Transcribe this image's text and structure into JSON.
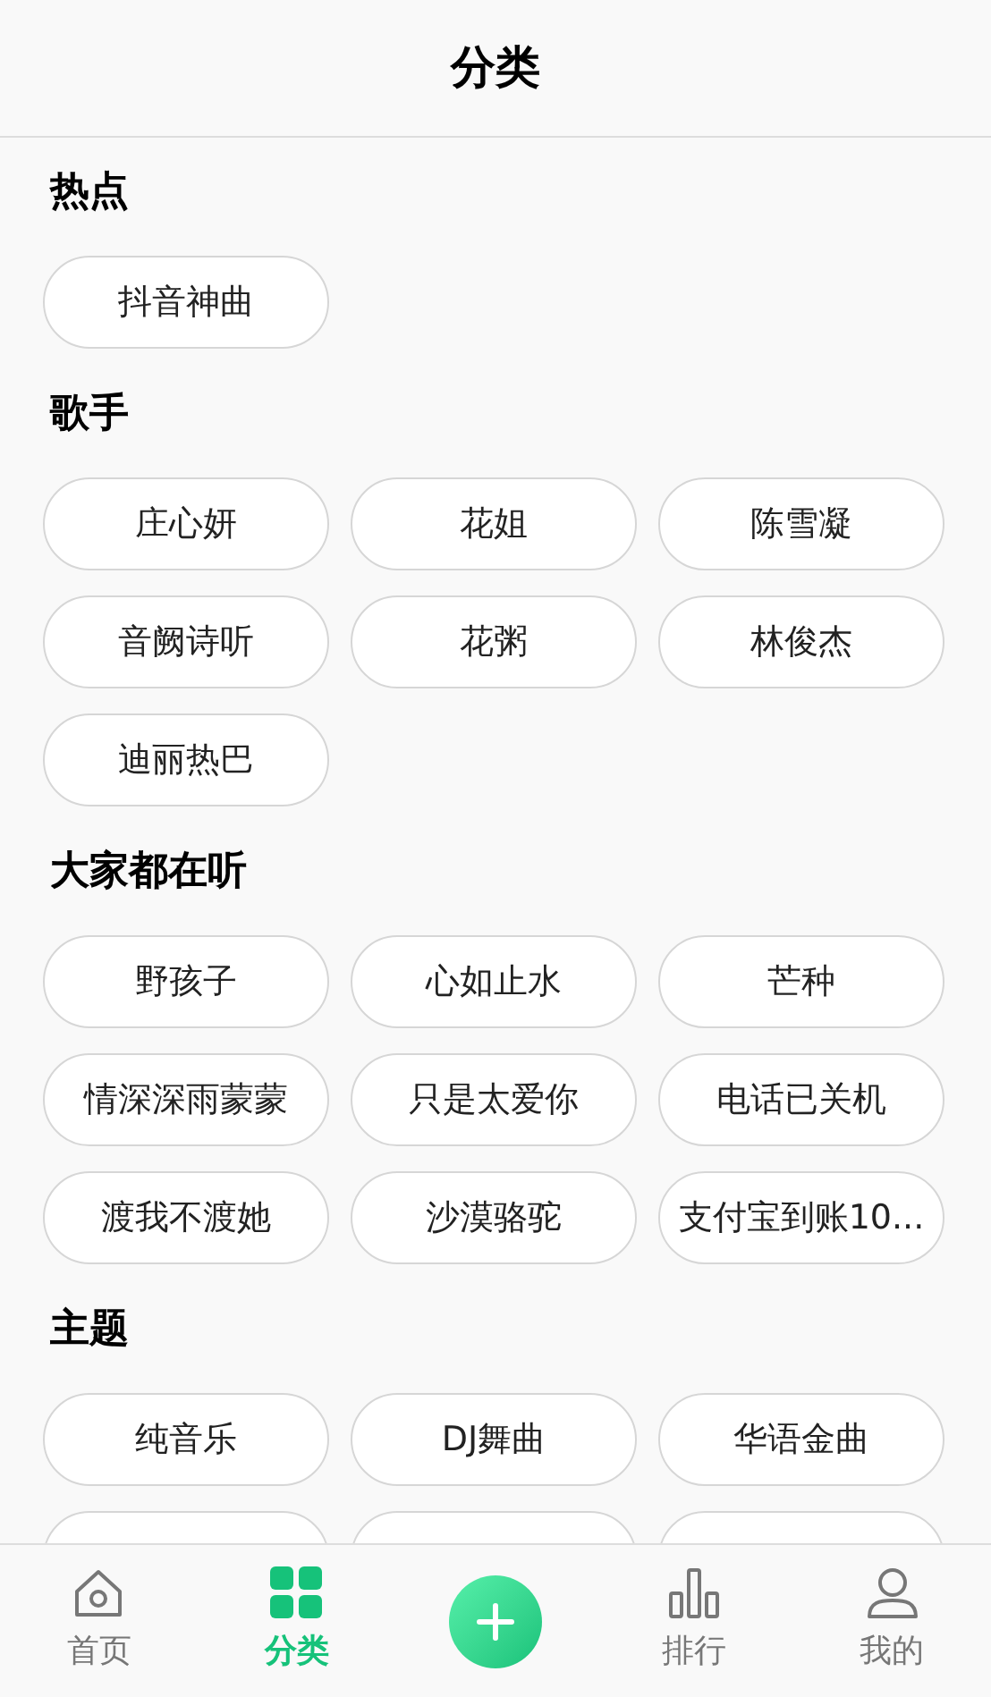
{
  "header": {
    "title": "分类"
  },
  "sections": [
    {
      "title": "热点",
      "tags": [
        {
          "kind": "tag",
          "label": "抖音神曲"
        }
      ]
    },
    {
      "title": "歌手",
      "tags": [
        {
          "kind": "tag",
          "label": "庄心妍"
        },
        {
          "kind": "tag",
          "label": "花姐"
        },
        {
          "kind": "tag",
          "label": "陈雪凝"
        },
        {
          "kind": "tag",
          "label": "音阙诗听"
        },
        {
          "kind": "tag",
          "label": "花粥"
        },
        {
          "kind": "tag",
          "label": "林俊杰"
        },
        {
          "kind": "tag",
          "label": "迪丽热巴"
        }
      ]
    },
    {
      "title": "大家都在听",
      "tags": [
        {
          "kind": "tag",
          "label": "野孩子"
        },
        {
          "kind": "tag",
          "label": "心如止水"
        },
        {
          "kind": "tag",
          "label": "芒种"
        },
        {
          "kind": "tag",
          "label": "情深深雨蒙蒙"
        },
        {
          "kind": "tag",
          "label": "只是太爱你"
        },
        {
          "kind": "tag",
          "label": "电话已关机"
        },
        {
          "kind": "tag",
          "label": "渡我不渡她"
        },
        {
          "kind": "tag",
          "label": "沙漠骆驼"
        },
        {
          "kind": "tag",
          "label": "支付宝到账10..."
        }
      ]
    },
    {
      "title": "主题",
      "tags": [
        {
          "kind": "tag",
          "label": "纯音乐"
        },
        {
          "kind": "tag",
          "label": "DJ舞曲"
        },
        {
          "kind": "tag",
          "label": "华语金曲"
        },
        {
          "kind": "cut"
        },
        {
          "kind": "cut"
        },
        {
          "kind": "cut"
        }
      ]
    }
  ],
  "nav": [
    {
      "kind": "home",
      "label": "首页",
      "selected": false
    },
    {
      "kind": "grid",
      "label": "分类",
      "selected": true
    },
    {
      "kind": "add"
    },
    {
      "kind": "chart",
      "label": "排行",
      "selected": false
    },
    {
      "kind": "user",
      "label": "我的",
      "selected": false
    }
  ]
}
